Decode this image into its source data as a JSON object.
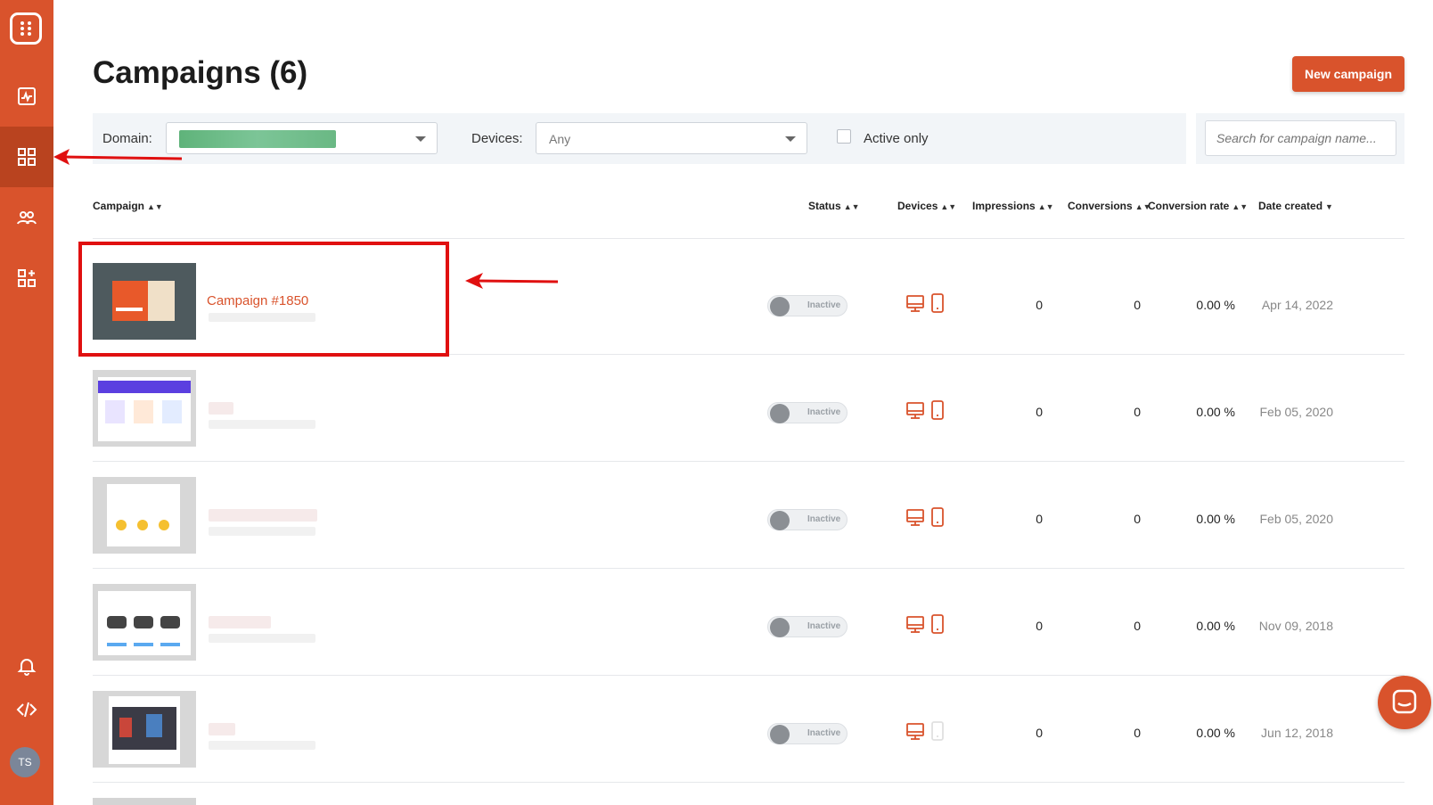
{
  "page": {
    "title": "Campaigns (6)",
    "new_button": "New campaign"
  },
  "sidebar": {
    "items": [
      {
        "name": "analytics-icon",
        "active": false
      },
      {
        "name": "campaigns-grid-icon",
        "active": true
      },
      {
        "name": "subscribers-icon",
        "active": false
      },
      {
        "name": "templates-add-icon",
        "active": false
      }
    ],
    "bottom": [
      "bell-icon",
      "code-icon"
    ],
    "avatar_initials": "TS"
  },
  "filters": {
    "domain_label": "Domain:",
    "devices_label": "Devices:",
    "devices_value": "Any",
    "active_only_label": "Active only",
    "active_only_checked": false,
    "search_placeholder": "Search for campaign name..."
  },
  "table": {
    "columns": [
      "Campaign",
      "Status",
      "Devices",
      "Impressions",
      "Conversions",
      "Conversion rate",
      "Date created"
    ],
    "rows": [
      {
        "name": "Campaign #1850",
        "status": "Inactive",
        "desktop": true,
        "mobile": true,
        "impressions": "0",
        "conversions": "0",
        "rate": "0.00 %",
        "date": "Apr 14, 2022"
      },
      {
        "name": "",
        "status": "Inactive",
        "desktop": true,
        "mobile": true,
        "impressions": "0",
        "conversions": "0",
        "rate": "0.00 %",
        "date": "Feb 05, 2020"
      },
      {
        "name": "",
        "status": "Inactive",
        "desktop": true,
        "mobile": true,
        "impressions": "0",
        "conversions": "0",
        "rate": "0.00 %",
        "date": "Feb 05, 2020"
      },
      {
        "name": "",
        "status": "Inactive",
        "desktop": true,
        "mobile": true,
        "impressions": "0",
        "conversions": "0",
        "rate": "0.00 %",
        "date": "Nov 09, 2018"
      },
      {
        "name": "",
        "status": "Inactive",
        "desktop": true,
        "mobile": false,
        "impressions": "0",
        "conversions": "0",
        "rate": "0.00 %",
        "date": "Jun 12, 2018"
      }
    ]
  },
  "colors": {
    "brand": "#d9532c",
    "annotation": "#e01010"
  }
}
